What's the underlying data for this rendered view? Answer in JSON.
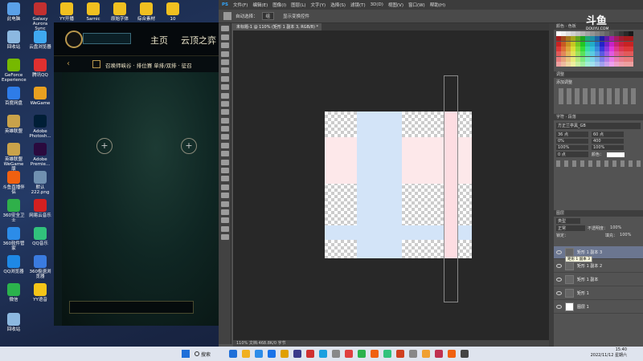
{
  "desktop": {
    "icons": [
      {
        "label": "此电脑",
        "color": "#5aa0e8"
      },
      {
        "label": "Galaxy Aurora Sync",
        "color": "#c23030"
      },
      {
        "label": "YY开播",
        "color": "#f0c020"
      },
      {
        "label": "Sarnic",
        "color": "#f0c020"
      },
      {
        "label": "原始字体",
        "color": "#f0c020"
      },
      {
        "label": "综合素材",
        "color": "#f0c020"
      },
      {
        "label": "10",
        "color": "#f0c020"
      },
      {
        "label": "回收站",
        "color": "#8cb8e0"
      },
      {
        "label": "云盘浏览器",
        "color": "#3fa8f0"
      },
      {
        "label": "GeForce Experience",
        "color": "#76b900"
      },
      {
        "label": "腾讯QQ",
        "color": "#e03030"
      },
      {
        "label": "百度网盘",
        "color": "#2e7ce8"
      },
      {
        "label": "WeGame",
        "color": "#e8a020"
      },
      {
        "label": "英雄联盟",
        "color": "#c9a24a"
      },
      {
        "label": "Adobe Photosh...",
        "color": "#001e36"
      },
      {
        "label": "英雄联盟 WeGame版",
        "color": "#c9a24a"
      },
      {
        "label": "Adobe Premie...",
        "color": "#2a0a3e"
      },
      {
        "label": "斗鱼直播伴侣",
        "color": "#f06010"
      },
      {
        "label": "默认222.png",
        "color": "#7090b0"
      },
      {
        "label": "360安全卫士",
        "color": "#2fb04a"
      },
      {
        "label": "网易云音乐",
        "color": "#d42020"
      },
      {
        "label": "360软件管家",
        "color": "#2c8ce8"
      },
      {
        "label": "QQ音乐",
        "color": "#31c27c"
      },
      {
        "label": "QQ浏览器",
        "color": "#1e88e5"
      },
      {
        "label": "360极速浏览器",
        "color": "#3a7be0"
      },
      {
        "label": "微信",
        "color": "#2bb24c"
      },
      {
        "label": "YY语音",
        "color": "#f5c518"
      },
      {
        "label": "回收站",
        "color": "#8cb8e0"
      }
    ]
  },
  "lol": {
    "nav_home": "主页",
    "nav_tft": "云顶之弈",
    "mode_title": "召唤师峡谷 · 排位赛 单排/双排 · 征召",
    "plus": "+"
  },
  "ps": {
    "menu": [
      "PS",
      "文件(F)",
      "编辑(E)",
      "图像(I)",
      "图层(L)",
      "文字(Y)",
      "选择(S)",
      "滤镜(T)",
      "3D(D)",
      "视图(V)",
      "窗口(W)",
      "帮助(H)"
    ],
    "options": {
      "auto_select": "自动选择：",
      "group": "组",
      "show_transform": "显示变换控件"
    },
    "tab_title": "未标题-1 @ 110% (矩形 1 副本 3, RGB/8) *",
    "status": "110%        文档:468.8K/0 字节",
    "color_panel": {
      "title": "颜色",
      "swatches_tab": "色板"
    },
    "adjust_panel": {
      "title": "调整",
      "label": "添加调整"
    },
    "char_panel": {
      "tab1": "字符",
      "tab2": "段落",
      "font": "方正兰亭黑_GB",
      "size": "36 点",
      "leading": "60 点",
      "tracking": "400",
      "scale": "0%",
      "vscale": "100%",
      "hscale": "100%",
      "baseline": "0 点",
      "color_label": "颜色："
    },
    "layers_panel": {
      "title": "图层",
      "kind": "类型",
      "mode": "正常",
      "opacity_label": "不透明度：",
      "opacity": "100%",
      "lock_label": "锁定：",
      "fill_label": "填充：",
      "fill": "100%",
      "layers": [
        {
          "name": "矩形 1 副本 3",
          "tooltip": "矩形 1 副本 3"
        },
        {
          "name": "矩形 1 副本 2"
        },
        {
          "name": "矩形 1 副本"
        },
        {
          "name": "矩形 1"
        },
        {
          "name": "图层 1"
        }
      ]
    },
    "watermark": "斗鱼",
    "watermark_sub": "DOUYU.COM"
  },
  "taskbar": {
    "search": "搜索",
    "time": "15:40",
    "date": "2022/11/12 星期六"
  }
}
